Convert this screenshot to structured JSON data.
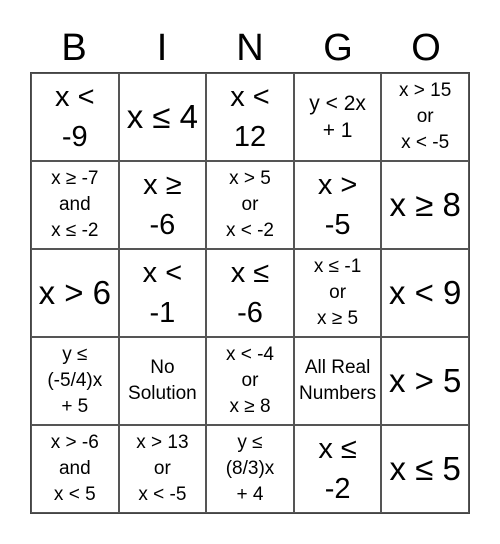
{
  "header": [
    "B",
    "I",
    "N",
    "G",
    "O"
  ],
  "cells": [
    {
      "text": "x <\n-9",
      "size": 1
    },
    {
      "text": "x ≤ 4",
      "size": 0
    },
    {
      "text": "x <\n12",
      "size": 1
    },
    {
      "text": "y < 2x\n+ 1",
      "size": 2
    },
    {
      "text": "x > 15\nor\nx < -5",
      "size": 3
    },
    {
      "text": "x ≥ -7\nand\nx ≤ -2",
      "size": 3
    },
    {
      "text": "x ≥\n-6",
      "size": 1
    },
    {
      "text": "x > 5\nor\nx < -2",
      "size": 3
    },
    {
      "text": "x >\n-5",
      "size": 1
    },
    {
      "text": "x ≥ 8",
      "size": 0
    },
    {
      "text": "x > 6",
      "size": 0
    },
    {
      "text": "x <\n-1",
      "size": 1
    },
    {
      "text": "x ≤\n-6",
      "size": 1
    },
    {
      "text": "x ≤ -1\nor\nx ≥ 5",
      "size": 3
    },
    {
      "text": "x < 9",
      "size": 0
    },
    {
      "text": "y ≤\n(-5/4)x\n+ 5",
      "size": 3
    },
    {
      "text": "No\nSolution",
      "size": 3
    },
    {
      "text": "x < -4\nor\nx ≥ 8",
      "size": 3
    },
    {
      "text": "All Real\nNumbers",
      "size": 3
    },
    {
      "text": "x > 5",
      "size": 0
    },
    {
      "text": "x > -6\nand\nx < 5",
      "size": 3
    },
    {
      "text": "x > 13\nor\nx < -5",
      "size": 3
    },
    {
      "text": "y ≤\n(8/3)x\n+ 4",
      "size": 3
    },
    {
      "text": "x ≤\n-2",
      "size": 1
    },
    {
      "text": "x ≤ 5",
      "size": 0
    }
  ]
}
